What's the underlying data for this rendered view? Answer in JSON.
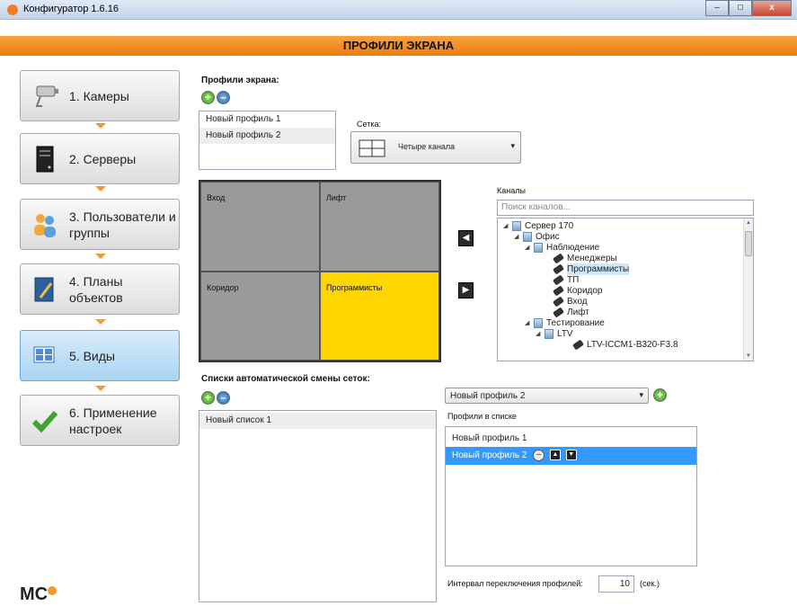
{
  "window": {
    "title": "Конфигуратор 1.6.16",
    "minimize": "–",
    "maximize": "□",
    "close": "x"
  },
  "header": {
    "title": "ПРОФИЛИ ЭКРАНА"
  },
  "sidebar": {
    "items": [
      {
        "label": "1. Камеры",
        "icon": "camera-icon"
      },
      {
        "label": "2. Серверы",
        "icon": "server-icon"
      },
      {
        "label": "3. Пользователи и группы",
        "icon": "users-icon"
      },
      {
        "label": "4. Планы объектов",
        "icon": "plans-icon"
      },
      {
        "label": "5. Виды",
        "icon": "views-icon",
        "active": true
      },
      {
        "label": "6. Применение настроек",
        "icon": "checkmark-icon"
      }
    ],
    "logo": "MC"
  },
  "profiles": {
    "title": "Профили экрана:",
    "add": "+",
    "remove": "–",
    "items": [
      "Новый профиль 1",
      "Новый профиль 2"
    ]
  },
  "grid_select": {
    "label": "Сетка:",
    "value": "Четыре канала",
    "arrow": "▾"
  },
  "layout_cells": [
    "Вход",
    "Лифт",
    "Коридор",
    "Программисты"
  ],
  "move": {
    "left": "◀",
    "right": "▶"
  },
  "channels": {
    "title": "Каналы",
    "search_placeholder": "Поиск каналов...",
    "tree": [
      {
        "label": "Сервер 170",
        "kind": "server",
        "twist": "◢"
      },
      {
        "label": "Офис",
        "kind": "server",
        "twist": "◢"
      },
      {
        "label": "Наблюдение",
        "kind": "server",
        "twist": "◢"
      },
      {
        "label": "Менеджеры",
        "kind": "camera",
        "twist": ""
      },
      {
        "label": "Программисты",
        "kind": "camera",
        "twist": "",
        "selected": true
      },
      {
        "label": "ТП",
        "kind": "camera",
        "twist": ""
      },
      {
        "label": "Коридор",
        "kind": "camera",
        "twist": ""
      },
      {
        "label": "Вход",
        "kind": "camera",
        "twist": ""
      },
      {
        "label": "Лифт",
        "kind": "camera",
        "twist": ""
      },
      {
        "label": "Тестирование",
        "kind": "server",
        "twist": "◢"
      },
      {
        "label": "LTV",
        "kind": "server",
        "twist": "◢"
      },
      {
        "label": "LTV-ICCM1-B320-F3.8",
        "kind": "camera",
        "twist": ""
      }
    ]
  },
  "auto_lists": {
    "title": "Списки автоматической смены сеток:",
    "add": "+",
    "remove": "–",
    "items": [
      "Новый список 1"
    ]
  },
  "profile_select": {
    "value": "Новый профиль 2",
    "arrow": "▾",
    "add": "+"
  },
  "profiles_in_list": {
    "label": "Профили в списке",
    "items": [
      "Новый профиль 1",
      "Новый профиль 2"
    ],
    "row_remove": "–",
    "row_up": "▲",
    "row_down": "▼"
  },
  "interval": {
    "label": "Интервал переключения профилей:",
    "value": "10",
    "unit": "(сек.)"
  }
}
